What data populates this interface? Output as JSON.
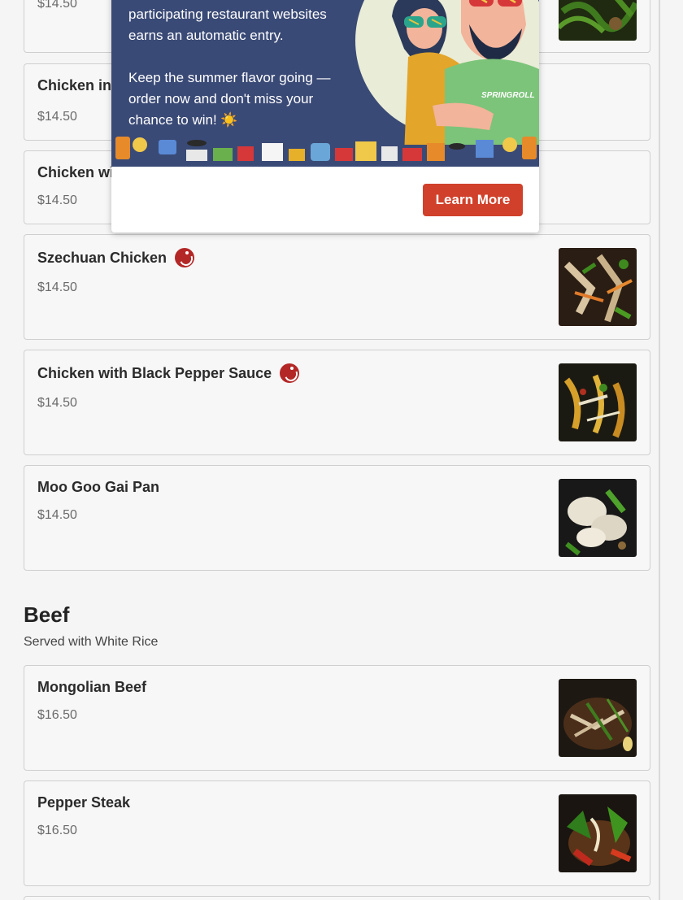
{
  "menu": {
    "items_top": [
      {
        "name": "",
        "price": "$14.50",
        "spicy": false
      },
      {
        "name": "Chicken in",
        "price": "$14.50",
        "spicy": false
      },
      {
        "name": "Chicken wi",
        "price": "$14.50",
        "spicy": false
      },
      {
        "name": "Szechuan Chicken",
        "price": "$14.50",
        "spicy": true
      },
      {
        "name": "Chicken with Black Pepper Sauce",
        "price": "$14.50",
        "spicy": true
      },
      {
        "name": "Moo Goo Gai Pan",
        "price": "$14.50",
        "spicy": false
      }
    ],
    "beef_section": {
      "title": "Beef",
      "subtitle": "Served with White Rice",
      "items": [
        {
          "name": "Mongolian Beef",
          "price": "$16.50"
        },
        {
          "name": "Pepper Steak",
          "price": "$16.50"
        }
      ]
    }
  },
  "popup": {
    "line1": "participating restaurant websites",
    "line2": "earns an automatic entry.",
    "para2_line1": "Keep the summer flavor going —",
    "para2_line2": "order now and don't miss your",
    "para2_line3": "chance to win! ☀️",
    "shirt_brand": "SPRINGROLL",
    "button_label": "Learn More"
  },
  "colors": {
    "accent": "#d0402a",
    "spicy": "#b42727",
    "banner_bg": "#3a4a76"
  }
}
